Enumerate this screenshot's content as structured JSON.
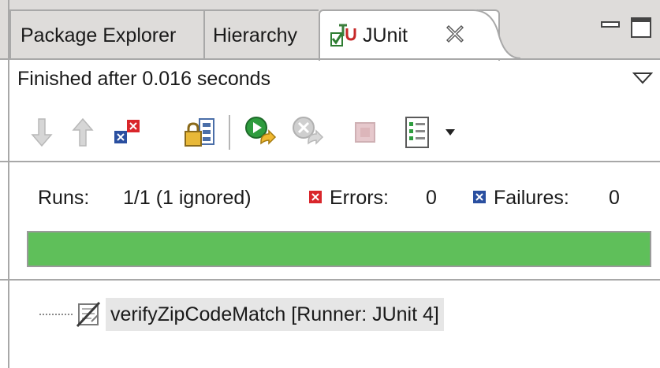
{
  "tabs": [
    {
      "label": "Package Explorer"
    },
    {
      "label": "Hierarchy"
    },
    {
      "label": "JUnit",
      "active": true
    }
  ],
  "status_text": "Finished after 0.016 seconds",
  "counters": {
    "runs_label": "Runs:",
    "runs_value": "1/1 (1 ignored)",
    "errors_label": "Errors:",
    "errors_value": "0",
    "failures_label": "Failures:",
    "failures_value": "0"
  },
  "progress": {
    "fraction": 1.0,
    "color": "#5fbf5a"
  },
  "tree": [
    {
      "label": "verifyZipCodeMatch [Runner: JUnit 4]",
      "icon": "ignored-test-icon"
    }
  ],
  "toolbar_icons": [
    "next-failure-icon",
    "previous-failure-icon",
    "show-failures-only-icon",
    "scroll-lock-icon",
    "rerun-test-icon",
    "rerun-failed-first-icon",
    "stop-icon",
    "test-run-history-icon",
    "history-dropdown-icon"
  ],
  "colors": {
    "error_red": "#d9262b",
    "failure_blue": "#2a4fa0",
    "progress_green": "#5fbf5a"
  }
}
